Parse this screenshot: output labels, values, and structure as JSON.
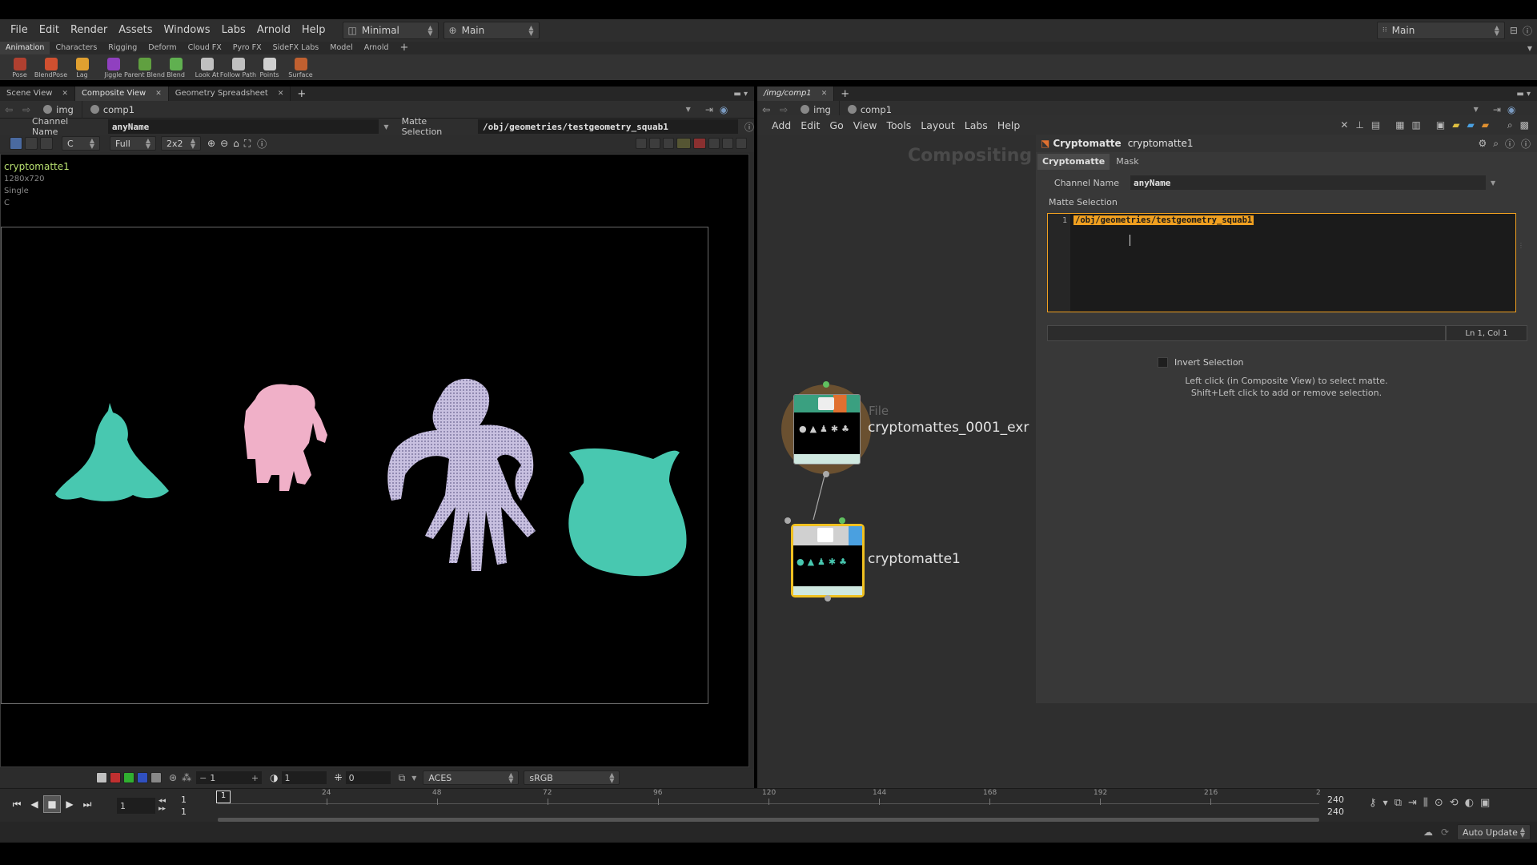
{
  "menubar": {
    "items": [
      "File",
      "Edit",
      "Render",
      "Assets",
      "Windows",
      "Labs",
      "Arnold",
      "Help"
    ],
    "desktop": "Minimal",
    "context": "Main",
    "right_context": "Main"
  },
  "shelf": {
    "tabs": [
      "Animation",
      "Characters",
      "Rigging",
      "Deform",
      "Cloud FX",
      "Pyro FX",
      "SideFX Labs",
      "Model",
      "Arnold"
    ],
    "tools": [
      {
        "label": "Pose",
        "color": "#b04030"
      },
      {
        "label": "BlendPose",
        "color": "#d05030"
      },
      {
        "label": "Lag",
        "color": "#e0a030"
      },
      {
        "label": "Jiggle",
        "color": "#9040c0"
      },
      {
        "label": "Parent Blend",
        "color": "#60a040"
      },
      {
        "label": "Blend",
        "color": "#60b050"
      },
      {
        "label": "Look At",
        "color": "#c0c0c0"
      },
      {
        "label": "Follow Path",
        "color": "#c0c0c0"
      },
      {
        "label": "Points",
        "color": "#d0d0d0"
      },
      {
        "label": "Surface",
        "color": "#c06030"
      }
    ]
  },
  "left": {
    "tabs": [
      "Scene View",
      "Composite View",
      "Geometry Spreadsheet"
    ],
    "path": [
      "img",
      "comp1"
    ],
    "channel_name_label": "Channel Name",
    "channel_name_value": "anyName",
    "matte_selection_label": "Matte Selection",
    "matte_selection_value": "/obj/geometries/testgeometry_squab1",
    "plane": "C",
    "resolution_mode": "Full",
    "zoom_mode": "2x2",
    "info": {
      "name": "cryptomatte1",
      "size": "1280x720",
      "type": "Single",
      "plane": "C"
    },
    "bottom": {
      "frame_step": "1",
      "gamma": "1",
      "offset": "0",
      "ocio": "ACES",
      "display": "sRGB"
    }
  },
  "right": {
    "tab": "/img/comp1",
    "path": [
      "img",
      "comp1"
    ],
    "menu": [
      "Add",
      "Edit",
      "Go",
      "View",
      "Tools",
      "Layout",
      "Labs",
      "Help"
    ],
    "network_context": "Compositing",
    "nodes": {
      "file_type": "File",
      "file_name": "cryptomattes_0001_exr",
      "crypto_name": "cryptomatte1"
    }
  },
  "params": {
    "node_type": "Cryptomatte",
    "node_name": "cryptomatte1",
    "tabs": [
      "Cryptomatte",
      "Mask"
    ],
    "channel_name_label": "Channel Name",
    "channel_name_value": "anyName",
    "matte_selection_label": "Matte Selection",
    "line_number": "1",
    "matte_text": "/obj/geometries/testgeometry_squab1",
    "cursor_pos": "Ln 1, Col 1",
    "invert_label": "Invert Selection",
    "help_1": "Left click (in Composite View) to select matte.",
    "help_2": "Shift+Left click to add or remove selection."
  },
  "timeline": {
    "current_frame": "1",
    "start": "1",
    "start2": "1",
    "end": "240",
    "end2": "240",
    "ticks": [
      "24",
      "48",
      "72",
      "96",
      "120",
      "144",
      "168",
      "192",
      "216",
      "2"
    ],
    "marker": "1"
  },
  "status": {
    "update_mode": "Auto Update"
  },
  "colors": {
    "teal": "#48c8b0",
    "pink": "#f0b0c8",
    "lavender": "#c8c0e0",
    "accent": "#f0a020"
  }
}
